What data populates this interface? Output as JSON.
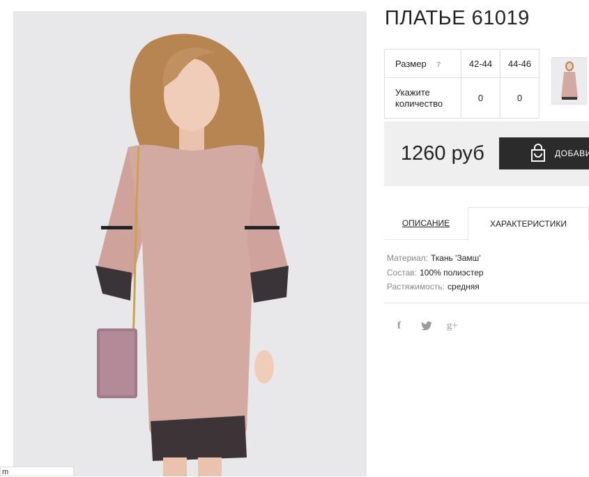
{
  "product": {
    "title": "ПЛАТЬЕ 61019",
    "photo_caption": "m"
  },
  "size_table": {
    "size_label": "Размер",
    "help_mark": "?",
    "sizes": [
      "42-44",
      "44-46"
    ],
    "quantity_label": "Укажите количество",
    "quantities": [
      "0",
      "0"
    ]
  },
  "purchase": {
    "price": "1260 руб",
    "add_button_label": "ДОБАВИ",
    "icon": "shopping-bag-icon"
  },
  "tabs": [
    {
      "label": "ОПИСАНИЕ",
      "active": false
    },
    {
      "label": "ХАРАКТЕРИСТИКИ",
      "active": true
    }
  ],
  "specs": [
    {
      "key": "Материал:",
      "value": "Ткань 'Замш'"
    },
    {
      "key": "Состав:",
      "value": "100% полиэстер"
    },
    {
      "key": "Растяжимость:",
      "value": "средняя"
    }
  ],
  "social": {
    "facebook": "f",
    "twitter": "twitter-icon",
    "googleplus": "g+"
  },
  "colors": {
    "dress": "#d3aaa2",
    "panel_bg": "#efefef",
    "button_bg": "#2b2b2b"
  }
}
